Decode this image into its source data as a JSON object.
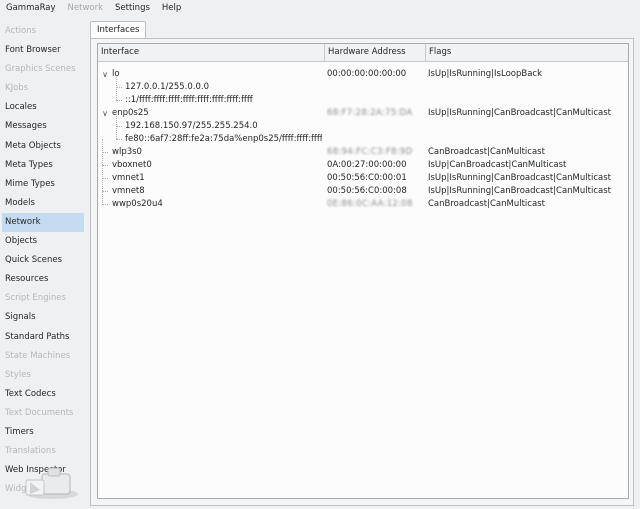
{
  "menubar": {
    "items": [
      {
        "label": "GammaRay",
        "enabled": true
      },
      {
        "label": "Network",
        "enabled": false
      },
      {
        "label": "Settings",
        "enabled": true
      },
      {
        "label": "Help",
        "enabled": true
      }
    ]
  },
  "sidebar": {
    "items": [
      {
        "label": "Actions",
        "enabled": false,
        "selected": false
      },
      {
        "label": "Font Browser",
        "enabled": true,
        "selected": false
      },
      {
        "label": "Graphics Scenes",
        "enabled": false,
        "selected": false
      },
      {
        "label": "KJobs",
        "enabled": false,
        "selected": false
      },
      {
        "label": "Locales",
        "enabled": true,
        "selected": false
      },
      {
        "label": "Messages",
        "enabled": true,
        "selected": false
      },
      {
        "label": "Meta Objects",
        "enabled": true,
        "selected": false
      },
      {
        "label": "Meta Types",
        "enabled": true,
        "selected": false
      },
      {
        "label": "Mime Types",
        "enabled": true,
        "selected": false
      },
      {
        "label": "Models",
        "enabled": true,
        "selected": false
      },
      {
        "label": "Network",
        "enabled": true,
        "selected": true
      },
      {
        "label": "Objects",
        "enabled": true,
        "selected": false
      },
      {
        "label": "Quick Scenes",
        "enabled": true,
        "selected": false
      },
      {
        "label": "Resources",
        "enabled": true,
        "selected": false
      },
      {
        "label": "Script Engines",
        "enabled": false,
        "selected": false
      },
      {
        "label": "Signals",
        "enabled": true,
        "selected": false
      },
      {
        "label": "Standard Paths",
        "enabled": true,
        "selected": false
      },
      {
        "label": "State Machines",
        "enabled": false,
        "selected": false
      },
      {
        "label": "Styles",
        "enabled": false,
        "selected": false
      },
      {
        "label": "Text Codecs",
        "enabled": true,
        "selected": false
      },
      {
        "label": "Text Documents",
        "enabled": false,
        "selected": false
      },
      {
        "label": "Timers",
        "enabled": true,
        "selected": false
      },
      {
        "label": "Translations",
        "enabled": false,
        "selected": false
      },
      {
        "label": "Web Inspector",
        "enabled": true,
        "selected": false
      },
      {
        "label": "Widgets",
        "enabled": false,
        "selected": false
      }
    ]
  },
  "tab": {
    "label": "Interfaces"
  },
  "table": {
    "headers": [
      "Interface",
      "Hardware Address",
      "Flags"
    ],
    "rows": [
      {
        "name": "lo",
        "hw": "00:00:00:00:00:00",
        "hw_blurred": false,
        "flags": "IsUp|IsRunning|IsLoopBack",
        "level": 0,
        "expandable": true
      },
      {
        "name": "127.0.0.1/255.0.0.0",
        "hw": "",
        "hw_blurred": false,
        "flags": "",
        "level": 1,
        "expandable": false
      },
      {
        "name": "::1/ffff:ffff:ffff:ffff:ffff:ffff:ffff:ffff",
        "hw": "",
        "hw_blurred": false,
        "flags": "",
        "level": 1,
        "expandable": false
      },
      {
        "name": "enp0s25",
        "hw": "68:F7:28:2A:75:DA",
        "hw_blurred": true,
        "flags": "IsUp|IsRunning|CanBroadcast|CanMulticast",
        "level": 0,
        "expandable": true
      },
      {
        "name": "192.168.150.97/255.255.254.0",
        "hw": "",
        "hw_blurred": false,
        "flags": "",
        "level": 1,
        "expandable": false
      },
      {
        "name": "fe80::6af7:28ff:fe2a:75da%enp0s25/ffff:ffff:ffff:ffff::",
        "hw": "",
        "hw_blurred": false,
        "flags": "",
        "level": 1,
        "expandable": false
      },
      {
        "name": "wlp3s0",
        "hw": "68:94:FC:C3:F8:9D",
        "hw_blurred": true,
        "flags": "CanBroadcast|CanMulticast",
        "level": 0,
        "expandable": false
      },
      {
        "name": "vboxnet0",
        "hw": "0A:00:27:00:00:00",
        "hw_blurred": false,
        "flags": "IsUp|CanBroadcast|CanMulticast",
        "level": 0,
        "expandable": false
      },
      {
        "name": "vmnet1",
        "hw": "00:50:56:C0:00:01",
        "hw_blurred": false,
        "flags": "IsUp|IsRunning|CanBroadcast|CanMulticast",
        "level": 0,
        "expandable": false
      },
      {
        "name": "vmnet8",
        "hw": "00:50:56:C0:00:08",
        "hw_blurred": false,
        "flags": "IsUp|IsRunning|CanBroadcast|CanMulticast",
        "level": 0,
        "expandable": false
      },
      {
        "name": "wwp0s20u4",
        "hw": "0E:86:0C:AA:12:08",
        "hw_blurred": true,
        "flags": "CanBroadcast|CanMulticast",
        "level": 0,
        "expandable": false
      }
    ]
  },
  "colors": {
    "selection": "#c3dcf2",
    "disabled_text": "#b5b7b9"
  }
}
